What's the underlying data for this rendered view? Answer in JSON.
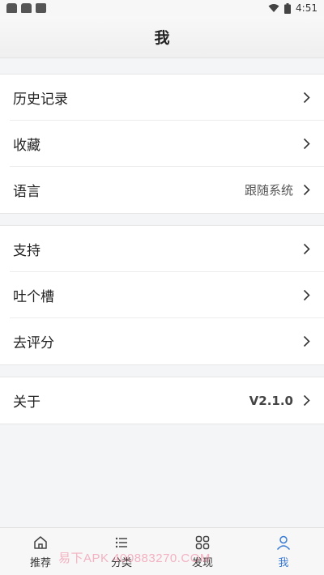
{
  "status_bar": {
    "time": "4:51"
  },
  "header": {
    "title": "我"
  },
  "groups": [
    [
      {
        "label": "历史记录",
        "value": ""
      },
      {
        "label": "收藏",
        "value": ""
      },
      {
        "label": "语言",
        "value": "跟随系统"
      }
    ],
    [
      {
        "label": "支持",
        "value": ""
      },
      {
        "label": "吐个槽",
        "value": ""
      },
      {
        "label": "去评分",
        "value": ""
      }
    ],
    [
      {
        "label": "关于",
        "value": "V2.1.0"
      }
    ]
  ],
  "tabs": [
    {
      "label": "推荐",
      "icon": "home-icon"
    },
    {
      "label": "分类",
      "icon": "list-icon"
    },
    {
      "label": "发现",
      "icon": "grid-icon"
    },
    {
      "label": "我",
      "icon": "user-icon",
      "active": true
    }
  ],
  "colors": {
    "accent": "#3a7bd5",
    "background": "#f4f5f6"
  },
  "watermark": "易下APK 400883270.COM"
}
